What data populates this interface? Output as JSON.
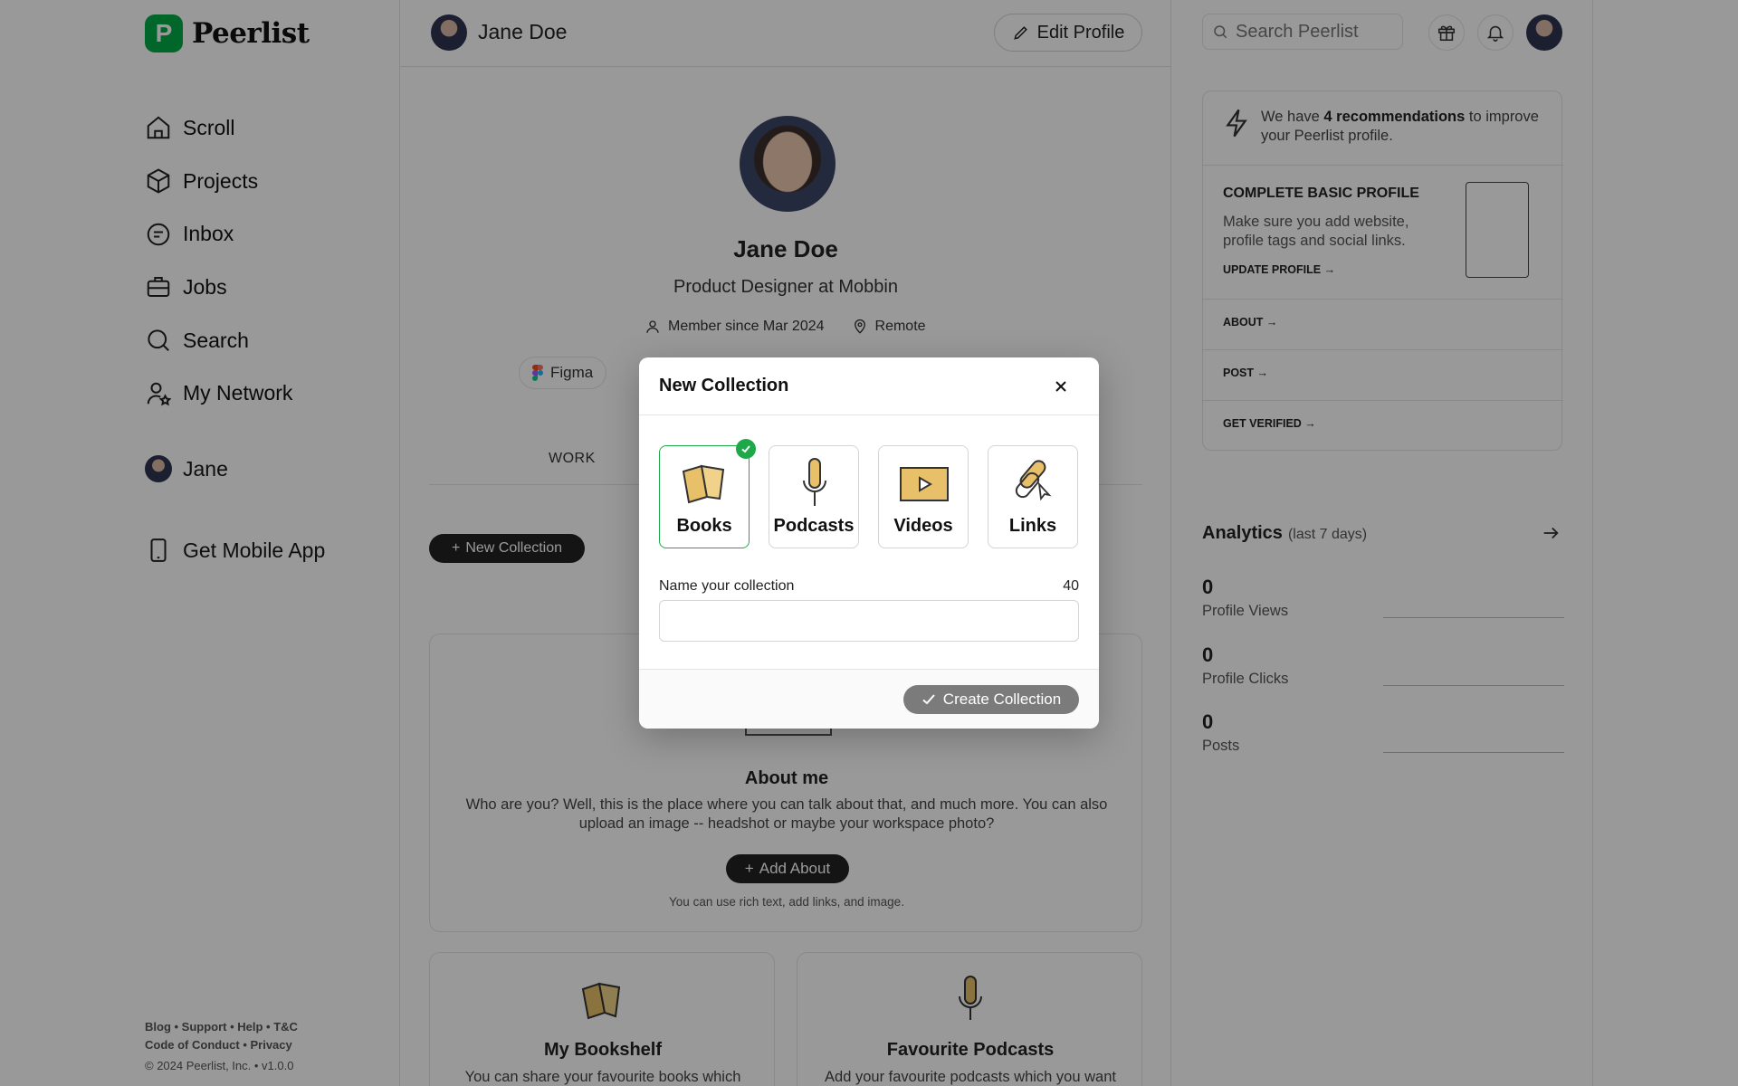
{
  "brand": {
    "name": "Peerlist",
    "mark": "P"
  },
  "sidebar": {
    "items": [
      {
        "label": "Scroll",
        "icon": "home-icon"
      },
      {
        "label": "Projects",
        "icon": "cube-icon"
      },
      {
        "label": "Inbox",
        "icon": "chat-icon"
      },
      {
        "label": "Jobs",
        "icon": "briefcase-icon"
      },
      {
        "label": "Search",
        "icon": "search-icon"
      },
      {
        "label": "My Network",
        "icon": "network-icon"
      }
    ],
    "user_label": "Jane",
    "mobile_app_label": "Get Mobile App",
    "footer_links": [
      "Blog",
      "Support",
      "Help",
      "T&C",
      "Code of Conduct",
      "Privacy"
    ],
    "footer_line1": "Blog • Support • Help • T&C",
    "footer_line2": "Code of Conduct • Privacy",
    "copyright": "© 2024 Peerlist, Inc. • v1.0.0"
  },
  "header": {
    "user_name": "Jane Doe",
    "edit_profile_label": "Edit Profile",
    "search_placeholder": "Search Peerlist"
  },
  "profile": {
    "name": "Jane Doe",
    "role": "Product Designer at Mobbin",
    "member_since": "Member since Mar 2024",
    "location": "Remote",
    "skill_tag": "Figma",
    "tab_work": "WORK",
    "new_collection_label": "New Collection",
    "about_title": "About me",
    "about_desc": "Who are you? Well, this is the place where you can talk about that, and much more. You can also upload an image -- headshot or maybe your workspace photo?",
    "add_about_label": "Add About",
    "about_hint": "You can use rich text, add links, and image.",
    "bookshelf_title": "My Bookshelf",
    "bookshelf_desc": "You can share your favourite books which",
    "podcasts_title": "Favourite Podcasts",
    "podcasts_desc": "Add your favourite podcasts which you want"
  },
  "recommendations": {
    "intro_before": "We have ",
    "intro_bold": "4 recommendations",
    "intro_after": " to improve your Peerlist profile.",
    "main_title": "COMPLETE BASIC PROFILE",
    "main_desc": "Make sure you add website, profile tags and social links.",
    "main_cta": "UPDATE PROFILE →",
    "rows": [
      "ABOUT →",
      "POST →",
      "GET VERIFIED →"
    ]
  },
  "analytics": {
    "title": "Analytics",
    "subtitle": "(last 7 days)",
    "stats": [
      {
        "value": "0",
        "label": "Profile Views"
      },
      {
        "value": "0",
        "label": "Profile Clicks"
      },
      {
        "value": "0",
        "label": "Posts"
      }
    ]
  },
  "modal": {
    "title": "New Collection",
    "types": [
      {
        "label": "Books",
        "icon": "book-icon",
        "selected": true
      },
      {
        "label": "Podcasts",
        "icon": "microphone-icon",
        "selected": false
      },
      {
        "label": "Videos",
        "icon": "video-icon",
        "selected": false
      },
      {
        "label": "Links",
        "icon": "link-icon",
        "selected": false
      }
    ],
    "name_label": "Name your collection",
    "char_count": "40",
    "name_value": "",
    "create_label": "Create Collection"
  },
  "colors": {
    "brand_green": "#00aa45",
    "selected_green": "#1ea84a",
    "book_yellow": "#e8c06a",
    "overlay": "rgba(0,0,0,0.40)"
  }
}
